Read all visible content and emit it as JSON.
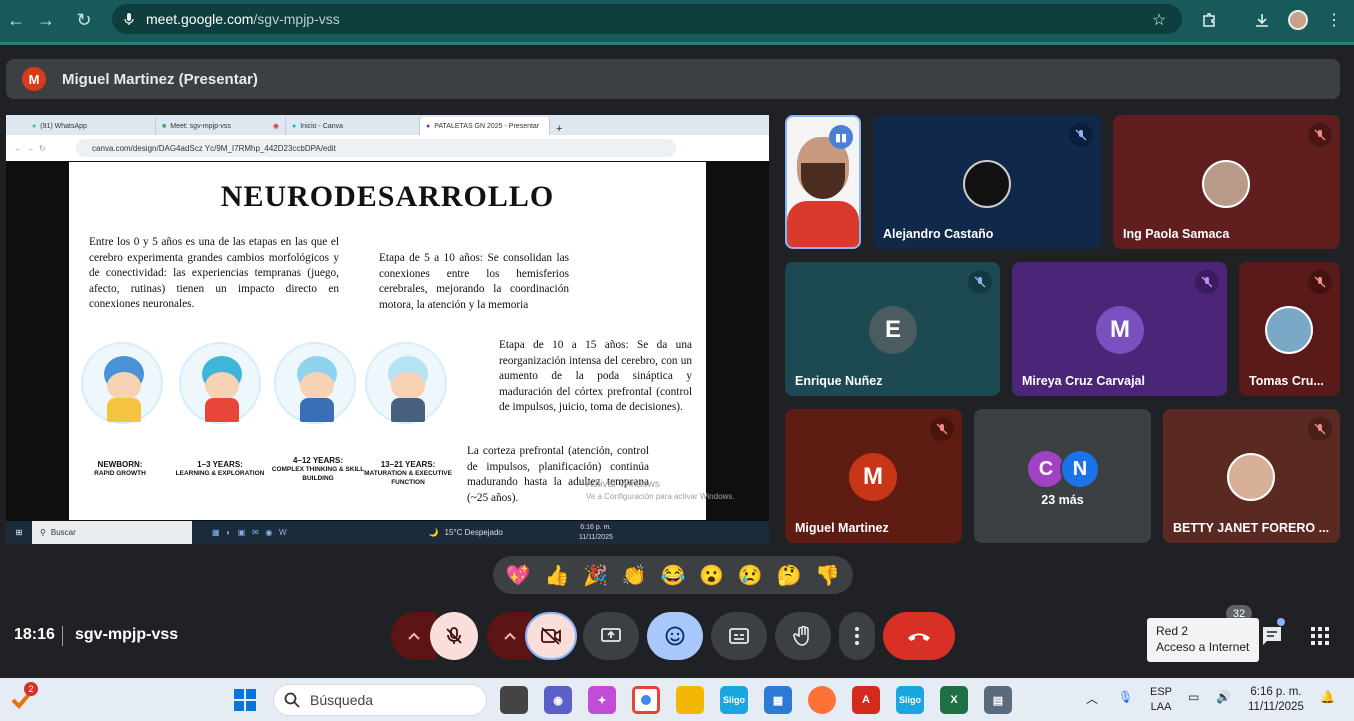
{
  "browser": {
    "url_host": "meet.google.com",
    "url_path": "/sgv-mpjp-vss"
  },
  "presenter_bar": {
    "avatar_letter": "M",
    "title": "Miguel Martinez (Presentar)"
  },
  "shared_screen": {
    "tabs": [
      {
        "label": "(91) WhatsApp"
      },
      {
        "label": "Meet: sgv-mpjp-vss"
      },
      {
        "label": "Inicio - Canva"
      },
      {
        "label": "PATALETAS GN 2025 - Presentar"
      }
    ],
    "address": "canva.com/design/DAG4adScz Yc/9M_I7RMhp_442D23ccbDPA/edit",
    "slide": {
      "title": "NEURODESARROLLO",
      "para1": "Entre los 0 y 5 años es una de las etapas en las que el cerebro experimenta grandes cambios morfológicos y de conectividad: las experiencias tempranas (juego, afecto, rutinas) tienen un impacto directo en conexiones neuronales.",
      "para2": "Etapa de 5 a 10 años: Se consolidan las conexiones entre los hemisferios cerebrales, mejorando la coordinación motora, la atención y la memoria",
      "para3": "Etapa de 10 a 15 años: Se da una reorganización intensa del cerebro, con un aumento de la poda sináptica y maduración del córtex prefrontal (control de impulsos, juicio, toma de decisiones).",
      "para4": "La corteza prefrontal (atención, control de impulsos, planificación) continúa madurando hasta la adultez temprana (~25 años).",
      "stages": [
        {
          "title": "NEWBORN:",
          "sub": "RAPID GROWTH"
        },
        {
          "title": "1–3 YEARS:",
          "sub": "LEARNING & EXPLORATION"
        },
        {
          "title": "4–12 YEARS:",
          "sub": "COMPLEX THINKING & SKILL BUILDING"
        },
        {
          "title": "13–21 YEARS:",
          "sub": "MATURATION & EXECUTIVE FUNCTION"
        }
      ],
      "watermark1": "Activar Windows",
      "watermark2": "Ve a Configuración para activar Windows."
    },
    "taskbar": {
      "search": "Buscar",
      "weather": "15°C Despejado",
      "time": "6:16 p. m.",
      "date": "11/11/2025"
    }
  },
  "participants": [
    {
      "name": "",
      "muted": false
    },
    {
      "name": "Alejandro Castaño",
      "muted": true
    },
    {
      "name": "Ing Paola Samaca",
      "muted": true
    },
    {
      "name": "Enrique Nuñez",
      "letter": "E",
      "muted": true
    },
    {
      "name": "Mireya Cruz Carvajal",
      "letter": "M",
      "muted": true
    },
    {
      "name": "Tomas Cru...",
      "muted": true
    },
    {
      "name": "Miguel Martinez",
      "letter": "M",
      "muted": true
    },
    {
      "name": "23 más",
      "letters": [
        "C",
        "N"
      ]
    },
    {
      "name": "BETTY JANET FORERO ...",
      "muted": true
    }
  ],
  "reactions": [
    "💖",
    "👍",
    "🎉",
    "👏",
    "😂",
    "😮",
    "😢",
    "🤔",
    "👎"
  ],
  "meeting": {
    "time": "18:16",
    "code": "sgv-mpjp-vss",
    "participant_count": "32"
  },
  "network_tooltip": {
    "line1": "Red 2",
    "line2": "Acceso a Internet"
  },
  "win_taskbar": {
    "search_placeholder": "Búsqueda",
    "notif_count": "2",
    "lang1": "ESP",
    "lang2": "LAA",
    "time": "6:16 p. m.",
    "date": "11/11/2025"
  }
}
